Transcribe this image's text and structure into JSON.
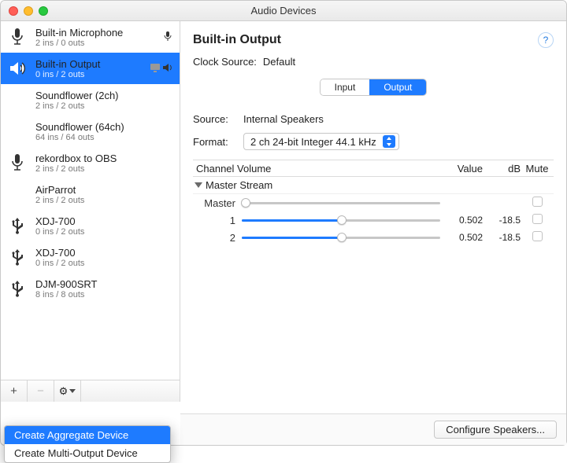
{
  "window": {
    "title": "Audio Devices"
  },
  "sidebar": {
    "devices": [
      {
        "name": "Built-in Microphone",
        "sub": "2 ins / 0 outs",
        "icon": "mic",
        "has_mic_indicator": true
      },
      {
        "name": "Built-in Output",
        "sub": "0 ins / 2 outs",
        "icon": "speaker",
        "selected": true,
        "has_output_indicator": true,
        "has_sys_indicator": true
      },
      {
        "name": "Soundflower (2ch)",
        "sub": "2 ins / 2 outs",
        "icon": "none"
      },
      {
        "name": "Soundflower (64ch)",
        "sub": "64 ins / 64 outs",
        "icon": "none"
      },
      {
        "name": "rekordbox to OBS",
        "sub": "2 ins / 2 outs",
        "icon": "mic"
      },
      {
        "name": "AirParrot",
        "sub": "2 ins / 2 outs",
        "icon": "none"
      },
      {
        "name": "XDJ-700",
        "sub": "0 ins / 2 outs",
        "icon": "usb"
      },
      {
        "name": "XDJ-700",
        "sub": "0 ins / 2 outs",
        "icon": "usb"
      },
      {
        "name": "DJM-900SRT",
        "sub": "8 ins / 8 outs",
        "icon": "usb"
      }
    ]
  },
  "toolbar": {
    "add": "+",
    "remove": "−",
    "gear": "⚙"
  },
  "details": {
    "title": "Built-in Output",
    "clock_label": "Clock Source:",
    "clock_value": "Default",
    "tabs": {
      "input": "Input",
      "output": "Output",
      "active": "output"
    },
    "source_label": "Source:",
    "source_value": "Internal Speakers",
    "format_label": "Format:",
    "format_value": "2 ch 24-bit Integer 44.1 kHz",
    "columns": {
      "name": "Channel Volume",
      "value": "Value",
      "db": "dB",
      "mute": "Mute"
    },
    "master_label": "Master Stream",
    "channels": [
      {
        "label": "Master",
        "value": "",
        "db": "",
        "pos": 0.02,
        "filled": false
      },
      {
        "label": "1",
        "value": "0.502",
        "db": "-18.5",
        "pos": 0.502,
        "filled": true
      },
      {
        "label": "2",
        "value": "0.502",
        "db": "-18.5",
        "pos": 0.502,
        "filled": true
      }
    ],
    "configure_btn": "Configure Speakers..."
  },
  "popup": {
    "items": [
      {
        "label": "Create Aggregate Device",
        "highlighted": true
      },
      {
        "label": "Create Multi-Output Device",
        "highlighted": false
      }
    ]
  }
}
